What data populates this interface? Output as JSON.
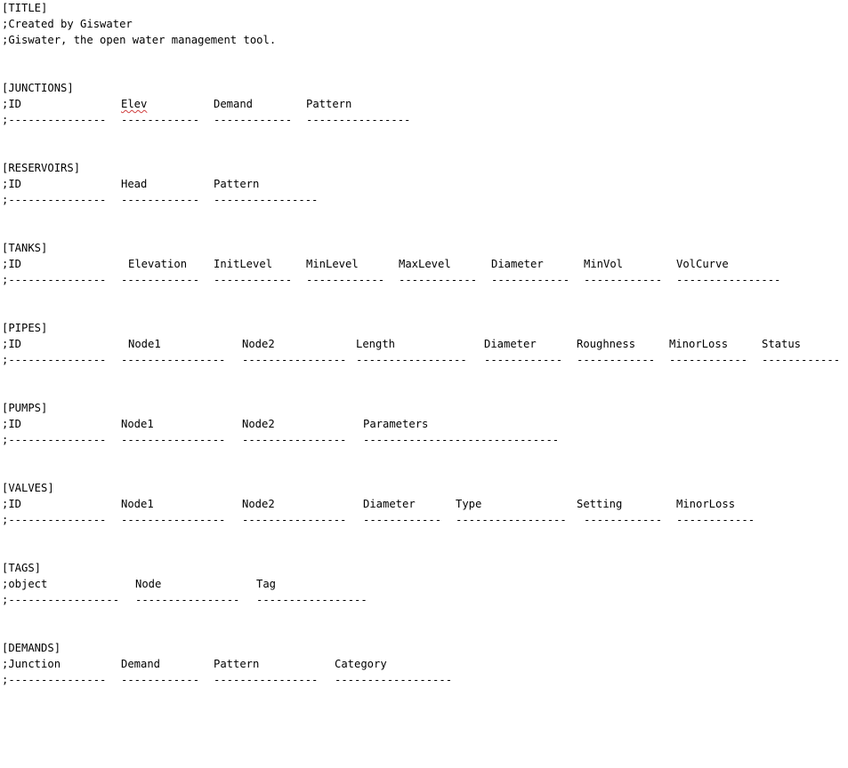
{
  "colors": {
    "text": "#000000",
    "background": "#ffffff",
    "spellcheck": "#d04040"
  },
  "title_section": {
    "header": "[TITLE]",
    "lines": [
      ";Created by Giswater",
      ";Giswater, the open water management tool."
    ]
  },
  "junctions": {
    "header": "[JUNCTIONS]",
    "columns": [
      ";ID",
      "Elev",
      "Demand",
      "Pattern"
    ],
    "separators": [
      ";---------------",
      "------------",
      "------------",
      "----------------"
    ]
  },
  "reservoirs": {
    "header": "[RESERVOIRS]",
    "columns": [
      ";ID",
      "Head",
      "Pattern"
    ],
    "separators": [
      ";---------------",
      "------------",
      "----------------"
    ]
  },
  "tanks": {
    "header": "[TANKS]",
    "columns": [
      ";ID",
      "Elevation",
      "InitLevel",
      "MinLevel",
      "MaxLevel",
      "Diameter",
      "MinVol",
      "VolCurve"
    ],
    "separators": [
      ";---------------",
      "------------",
      "------------",
      "------------",
      "------------",
      "------------",
      "------------",
      "----------------"
    ]
  },
  "pipes": {
    "header": "[PIPES]",
    "columns": [
      ";ID",
      "Node1",
      "Node2",
      "Length",
      "Diameter",
      "Roughness",
      "MinorLoss",
      "Status"
    ],
    "separators": [
      ";---------------",
      "----------------",
      "----------------",
      "-----------------",
      "------------",
      "------------",
      "------------",
      "------------"
    ]
  },
  "pumps": {
    "header": "[PUMPS]",
    "columns": [
      ";ID",
      "Node1",
      "Node2",
      "Parameters"
    ],
    "separators": [
      ";---------------",
      "----------------",
      "----------------",
      "------------------------------"
    ]
  },
  "valves": {
    "header": "[VALVES]",
    "columns": [
      ";ID",
      "Node1",
      "Node2",
      "Diameter",
      "Type",
      "Setting",
      "MinorLoss"
    ],
    "separators": [
      ";---------------",
      "----------------",
      "----------------",
      "------------",
      "-----------------",
      "------------",
      "------------"
    ]
  },
  "tags": {
    "header": "[TAGS]",
    "columns": [
      ";object",
      "Node",
      "Tag"
    ],
    "separators": [
      ";-----------------",
      "----------------",
      "-----------------"
    ]
  },
  "demands": {
    "header": "[DEMANDS]",
    "columns": [
      ";Junction",
      "Demand",
      "Pattern",
      "Category"
    ],
    "separators": [
      ";---------------",
      "------------",
      "----------------",
      "------------------"
    ]
  }
}
